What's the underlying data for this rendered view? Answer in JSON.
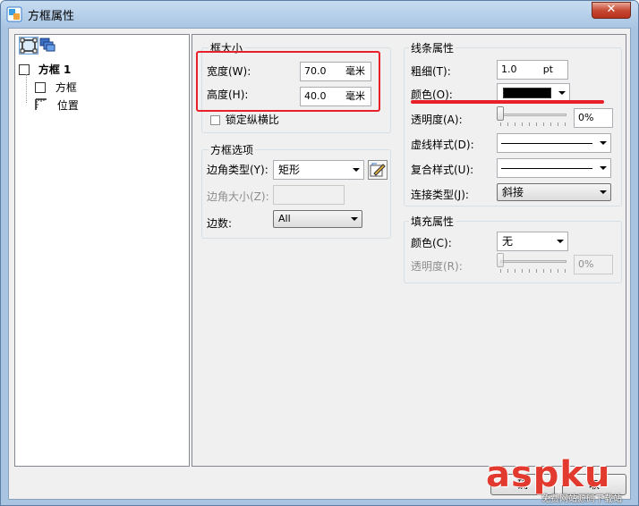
{
  "window": {
    "title": "方框属性",
    "close_label": "✕"
  },
  "tree": {
    "root_label": "方框 1",
    "items": [
      {
        "label": "方框"
      },
      {
        "label": "位置"
      }
    ]
  },
  "frame_size": {
    "title": "框大小",
    "width_label": "宽度(W):",
    "width_value": "70.0",
    "width_unit": "毫米",
    "height_label": "高度(H):",
    "height_value": "40.0",
    "height_unit": "毫米",
    "lock_label": "锁定纵横比"
  },
  "frame_options": {
    "title": "方框选项",
    "corner_type_label": "边角类型(Y):",
    "corner_type_value": "矩形",
    "corner_size_label": "边角大小(Z):",
    "corner_size_value": "",
    "edges_label": "边数:",
    "edges_value": "All"
  },
  "line_props": {
    "title": "线条属性",
    "thickness_label": "粗细(T):",
    "thickness_value": "1.0",
    "thickness_unit": "pt",
    "color_label": "颜色(O):",
    "color_value": "#000000",
    "transparency_label": "透明度(A):",
    "transparency_value": "0%",
    "transparency_fraction": 0,
    "dash_label": "虚线样式(D):",
    "compound_label": "复合样式(U):",
    "join_label": "连接类型(J):",
    "join_value": "斜接"
  },
  "fill_props": {
    "title": "填充属性",
    "color_label": "颜色(C):",
    "color_value": "无",
    "transparency_label": "透明度(R):",
    "transparency_value": "0%",
    "transparency_fraction": 0
  },
  "buttons": {
    "ok_label": "确",
    "cancel_label": "取"
  },
  "watermark": {
    "text": "aspku",
    "sub": "免费网站源码下载站"
  },
  "accent": {
    "highlight": "#e8202a",
    "selected_button": "#6ea2d6"
  }
}
